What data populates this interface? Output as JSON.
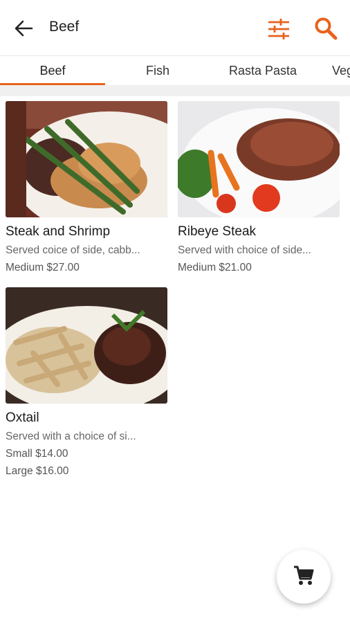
{
  "header": {
    "title": "Beef",
    "back_icon": "arrow-left-icon",
    "filter_icon": "sliders-icon",
    "search_icon": "search-icon",
    "accent": "#e8621c"
  },
  "tabs": [
    {
      "label": "Beef",
      "active": true
    },
    {
      "label": "Fish",
      "active": false
    },
    {
      "label": "Rasta Pasta",
      "active": false
    },
    {
      "label": "Veg",
      "active": false
    }
  ],
  "items": [
    {
      "name": "Steak and Shrimp",
      "description": "Served coice of side, cabb...",
      "prices": [
        "Medium $27.00"
      ]
    },
    {
      "name": "Ribeye Steak",
      "description": "Served with choice of side...",
      "prices": [
        "Medium $21.00"
      ]
    },
    {
      "name": "Oxtail",
      "description": "Served with a choice of si...",
      "prices": [
        "Small $14.00",
        "Large $16.00"
      ]
    }
  ],
  "cart": {
    "icon": "cart-icon"
  }
}
